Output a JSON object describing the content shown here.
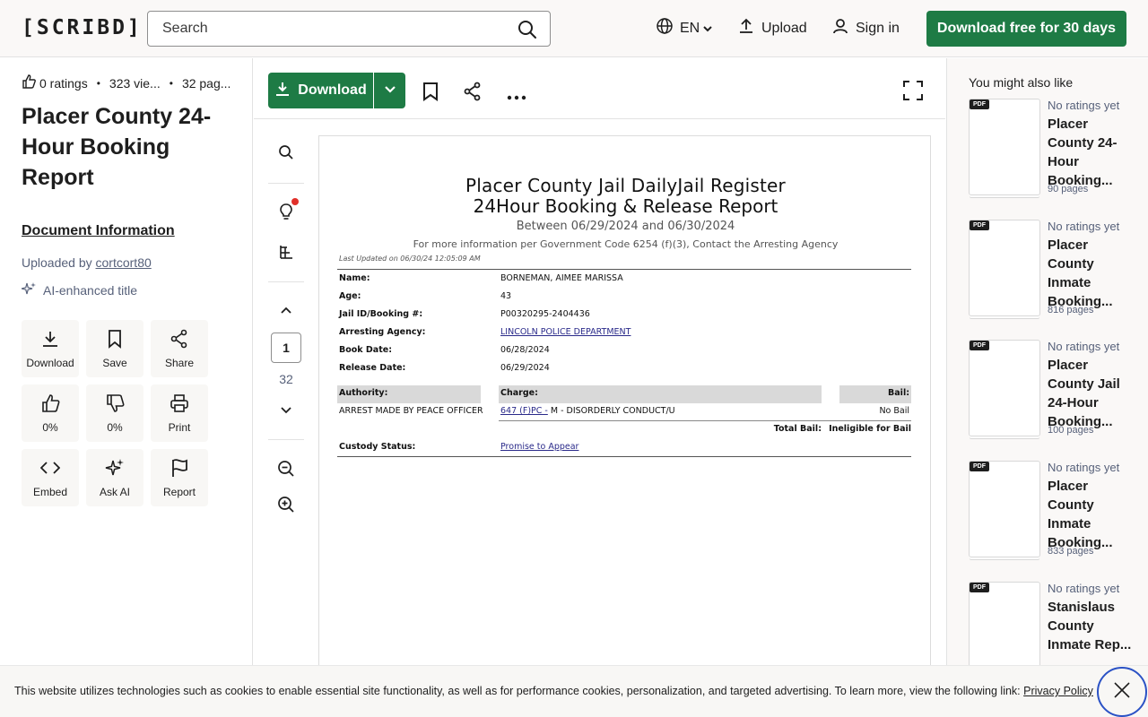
{
  "header": {
    "logo": "[SCRIBD]",
    "search_placeholder": "Search",
    "language": "EN",
    "upload": "Upload",
    "signin": "Sign in",
    "cta": "Download free for 30 days"
  },
  "document": {
    "ratings": "0 ratings",
    "views": "323 vie...",
    "pages": "32 pag...",
    "title": "Placer County 24-Hour Booking Report",
    "doc_info": "Document Information",
    "uploaded_by_prefix": "Uploaded by",
    "uploader": "cortcort80",
    "ai_title": "AI-enhanced title",
    "actions": [
      {
        "label": "Download",
        "icon": "download-icon"
      },
      {
        "label": "Save",
        "icon": "bookmark-icon"
      },
      {
        "label": "Share",
        "icon": "share-icon"
      },
      {
        "label": "0%",
        "icon": "thumbs-up-icon"
      },
      {
        "label": "0%",
        "icon": "thumbs-down-icon"
      },
      {
        "label": "Print",
        "icon": "print-icon"
      },
      {
        "label": "Embed",
        "icon": "code-icon"
      },
      {
        "label": "Ask AI",
        "icon": "sparkles-icon"
      },
      {
        "label": "Report",
        "icon": "flag-icon"
      }
    ]
  },
  "viewer": {
    "download_label": "Download",
    "current_page": "1",
    "total_pages": "32"
  },
  "page": {
    "title_line1": "Placer County Jail DailyJail Register",
    "title_line2": "24Hour Booking & Release Report",
    "date_range": "Between 06/29/2024 and 06/30/2024",
    "info_line": "For more information per Government Code 6254 (f)(3), Contact the Arresting Agency",
    "last_updated": "Last Updated on 06/30/24 12:05:09 AM",
    "fields": [
      {
        "label": "Name:",
        "value": "BORNEMAN, AIMEE MARISSA"
      },
      {
        "label": "Age:",
        "value": "43"
      },
      {
        "label": "Jail ID/Booking #:",
        "value": "P00320295-2404436"
      },
      {
        "label": "Arresting Agency:",
        "value": "LINCOLN POLICE DEPARTMENT"
      },
      {
        "label": "Book Date:",
        "value": "06/28/2024"
      },
      {
        "label": "Release Date:",
        "value": "06/29/2024"
      }
    ],
    "table_headers": {
      "authority": "Authority:",
      "charge": "Charge:",
      "bail": "Bail:"
    },
    "row": {
      "authority": "ARREST MADE BY PEACE OFFICER",
      "charge_code": "647 (F)PC -",
      "charge_desc": "M - DISORDERLY CONDUCT/U",
      "bail": "No Bail"
    },
    "total_bail_label": "Total Bail:",
    "total_bail_value": "Ineligible for Bail",
    "custody_label": "Custody Status:",
    "custody_value": "Promise to Appear"
  },
  "recommendations": {
    "heading": "You might also like",
    "items": [
      {
        "rating": "No ratings yet",
        "title": "Placer County 24-Hour Booking...",
        "pages": "90 pages"
      },
      {
        "rating": "No ratings yet",
        "title": "Placer County Inmate Booking...",
        "pages": "816 pages"
      },
      {
        "rating": "No ratings yet",
        "title": "Placer County Jail 24-Hour Booking...",
        "pages": "100 pages"
      },
      {
        "rating": "No ratings yet",
        "title": "Placer County Inmate Booking...",
        "pages": "833 pages"
      },
      {
        "rating": "No ratings yet",
        "title": "Stanislaus County Inmate Rep...",
        "pages": ""
      }
    ]
  },
  "cookie": {
    "text": "This website utilizes technologies such as cookies to enable essential site functionality, as well as for performance cookies, personalization, and targeted advertising. To learn more, view the following link:",
    "link": "Privacy Policy"
  }
}
